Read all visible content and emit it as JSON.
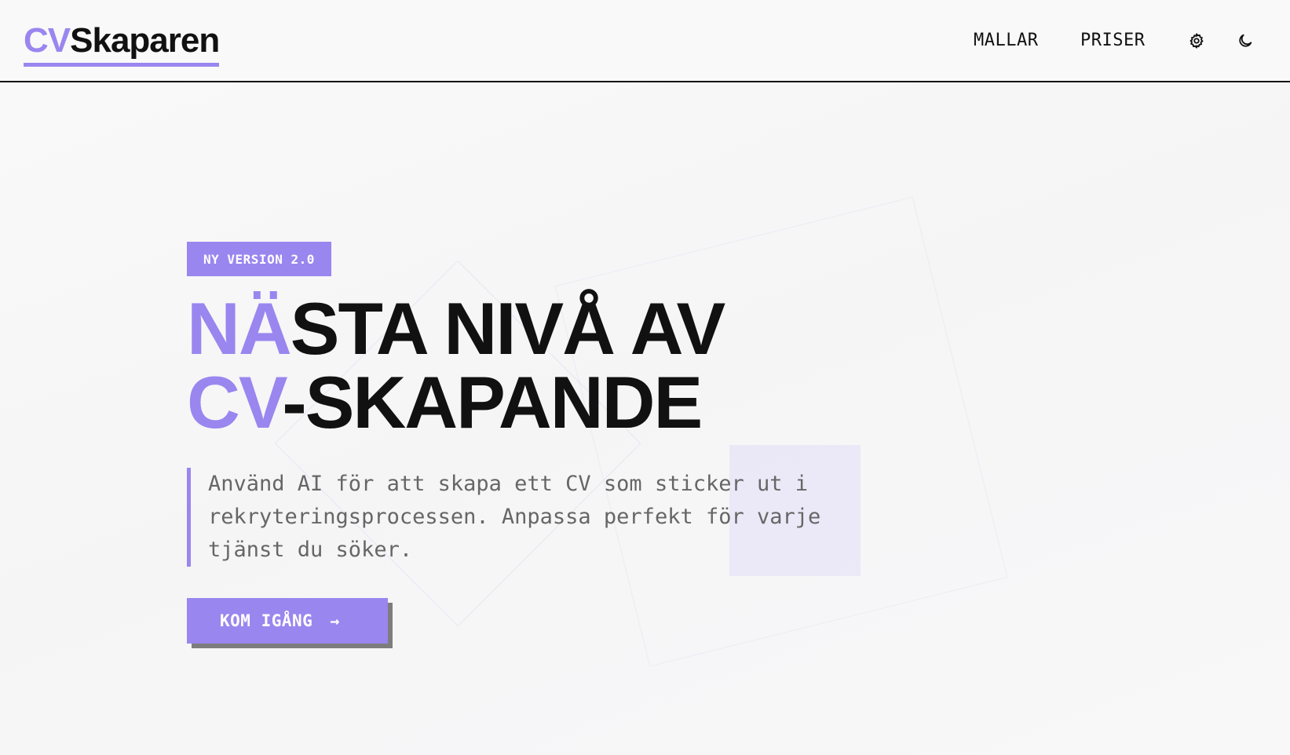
{
  "header": {
    "logo_accent": "CV",
    "logo_rest": "Skaparen",
    "nav": [
      {
        "label": "MALLAR"
      },
      {
        "label": "PRISER"
      }
    ],
    "icons": [
      "gear-icon",
      "moon-icon"
    ]
  },
  "hero": {
    "badge": "NY VERSION 2.0",
    "headline_line1_accent": "NÄ",
    "headline_line1_rest": "STA NIVÅ AV",
    "headline_line2_accent": "CV",
    "headline_line2_rest": "-SKAPANDE",
    "subtext": "Använd AI för att skapa ett CV som sticker ut i rekryteringsprocessen. Anpassa perfekt för varje tjänst du söker.",
    "cta_label": "KOM IGÅNG",
    "cta_arrow": "→"
  },
  "colors": {
    "accent": "#9a86ef",
    "text": "#111111",
    "muted": "#666666",
    "shadow": "#7d7d7d"
  }
}
